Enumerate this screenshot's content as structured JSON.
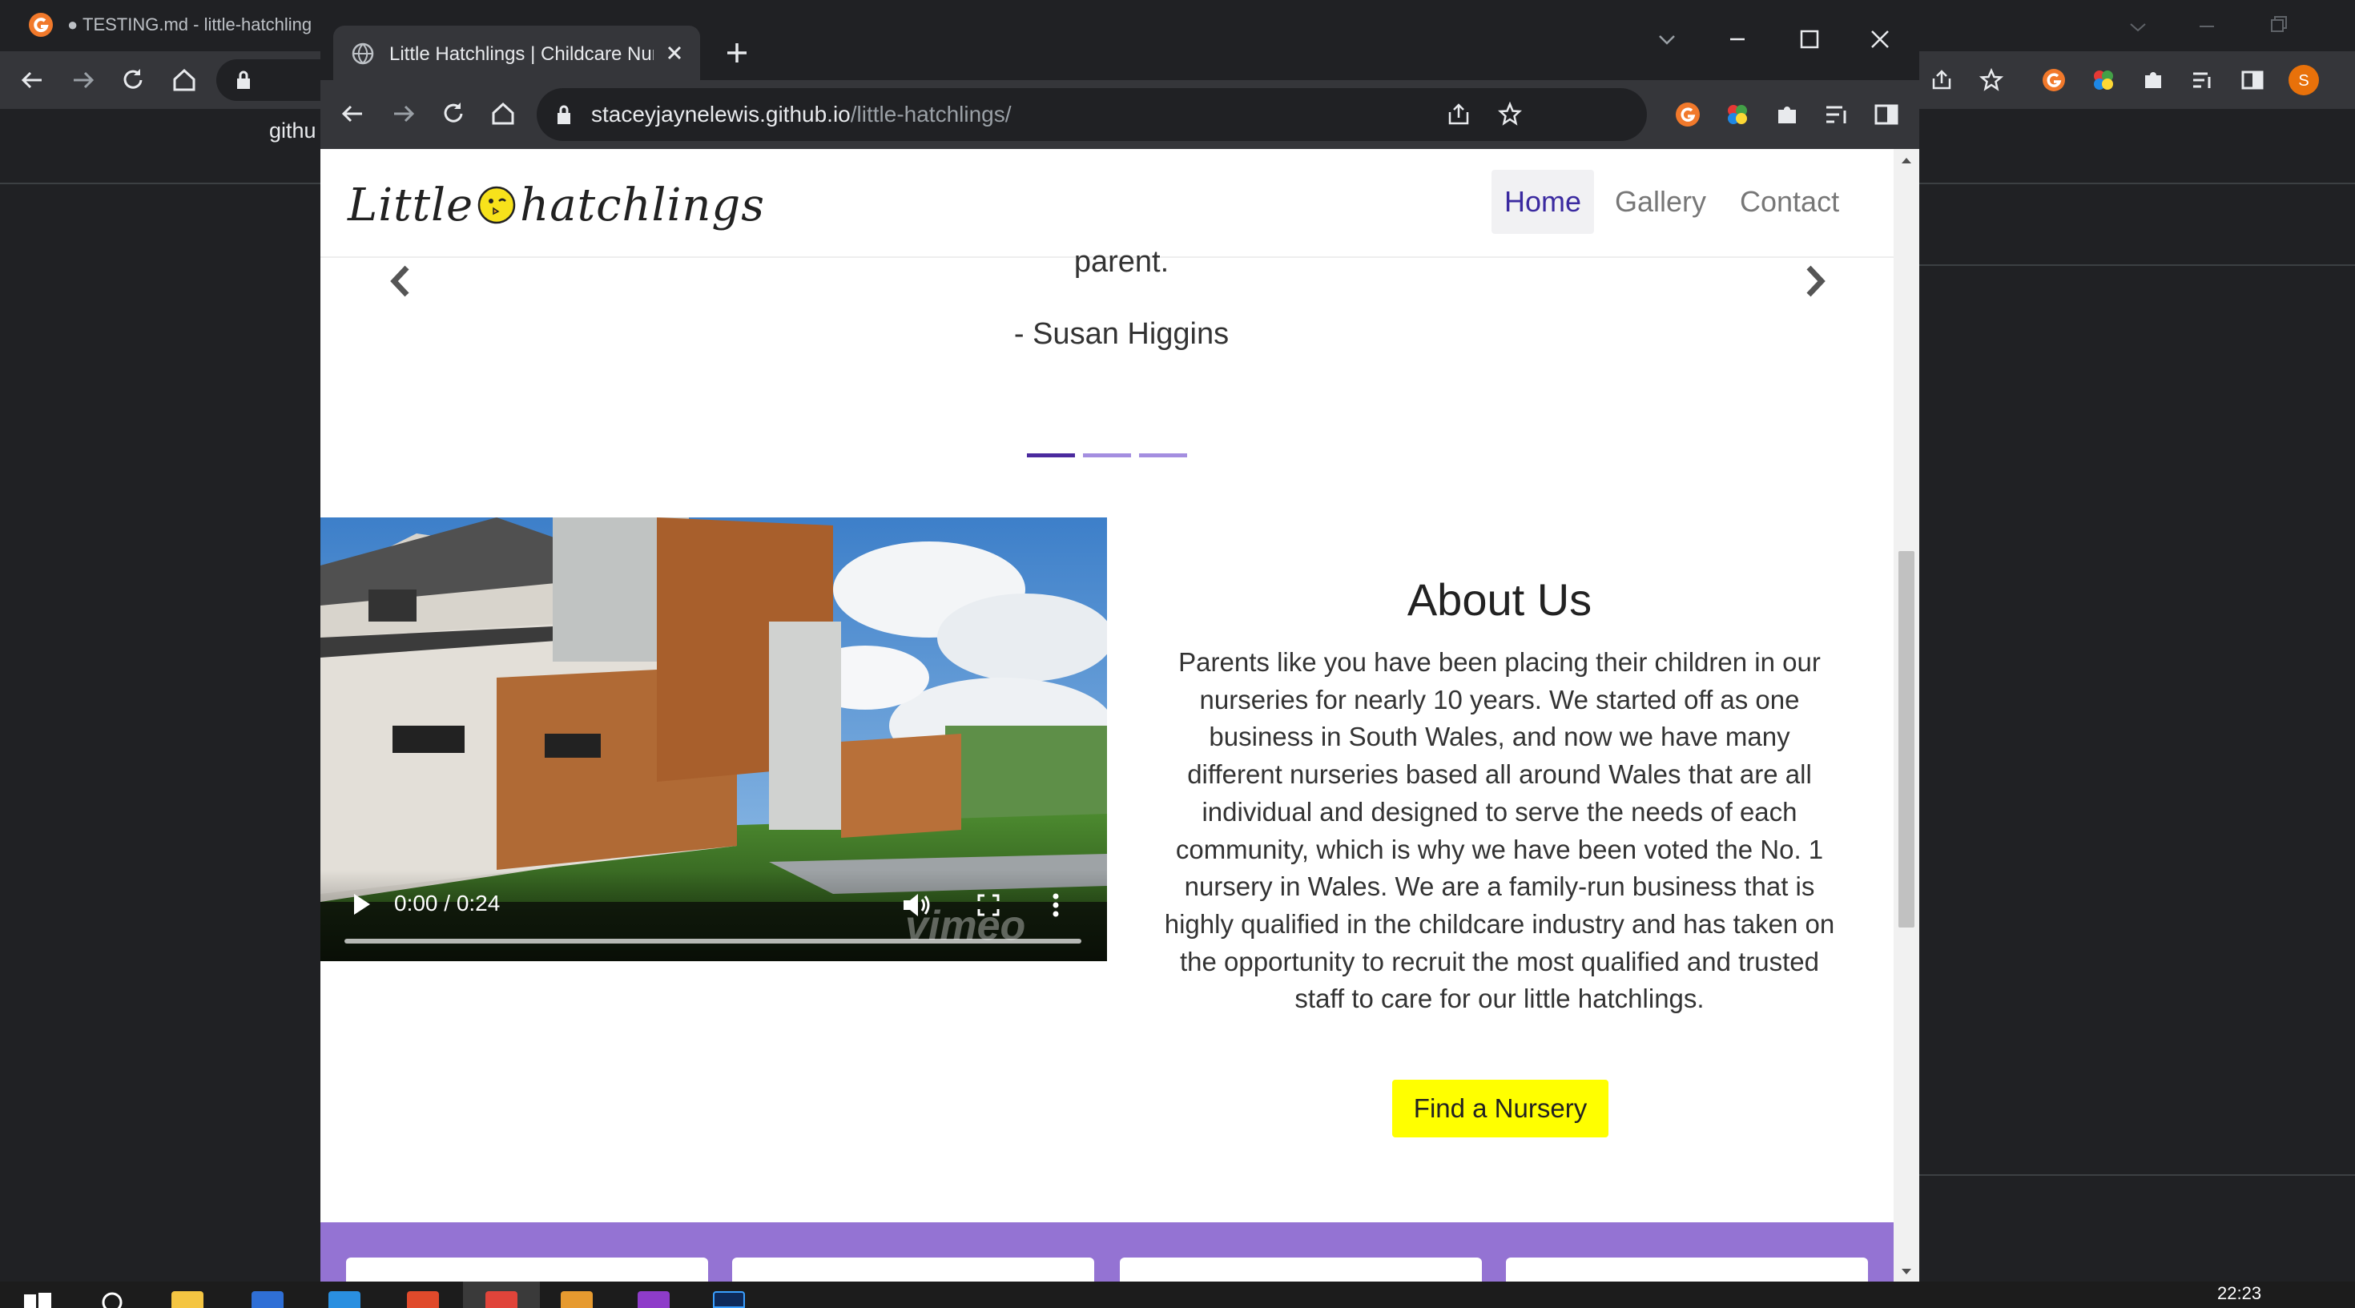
{
  "background_window": {
    "tab_title": "● TESTING.md - little-hatchling",
    "url_partial": "githu"
  },
  "browser": {
    "tab_title": "Little Hatchlings | Childcare Nurs",
    "url_host": "staceyjaynelewis.github.io",
    "url_path": "/little-hatchlings/",
    "profile_initial": "S"
  },
  "site": {
    "logo_text_a": "Little",
    "logo_text_b": "hatchlings",
    "nav": {
      "home": "Home",
      "gallery": "Gallery",
      "contact": "Contact"
    }
  },
  "testimonial": {
    "text_fragment": "parent.",
    "author": "- Susan Higgins",
    "slide_count": 3,
    "active_slide": 1
  },
  "video": {
    "time": "0:00 / 0:24",
    "watermark": "vimeo",
    "progress_fraction": 0
  },
  "about": {
    "title": "About Us",
    "body": "Parents like you have been placing their children in our nurseries for nearly 10 years. We started off as one business in South Wales, and now we have many different nurseries based all around Wales that are all individual and designed to serve the needs of each community, which is why we have been voted the No. 1 nursery in Wales. We are a family-run business that is highly qualified in the childcare industry and has taken on the opportunity to recruit the most qualified and trusted staff to care for our little hatchlings.",
    "cta": "Find a Nursery"
  },
  "taskbar": {
    "time": "22:23"
  },
  "colors": {
    "accent_purple": "#4b2a9e",
    "band_purple": "#9473d3",
    "cta_yellow": "#ffff00"
  }
}
